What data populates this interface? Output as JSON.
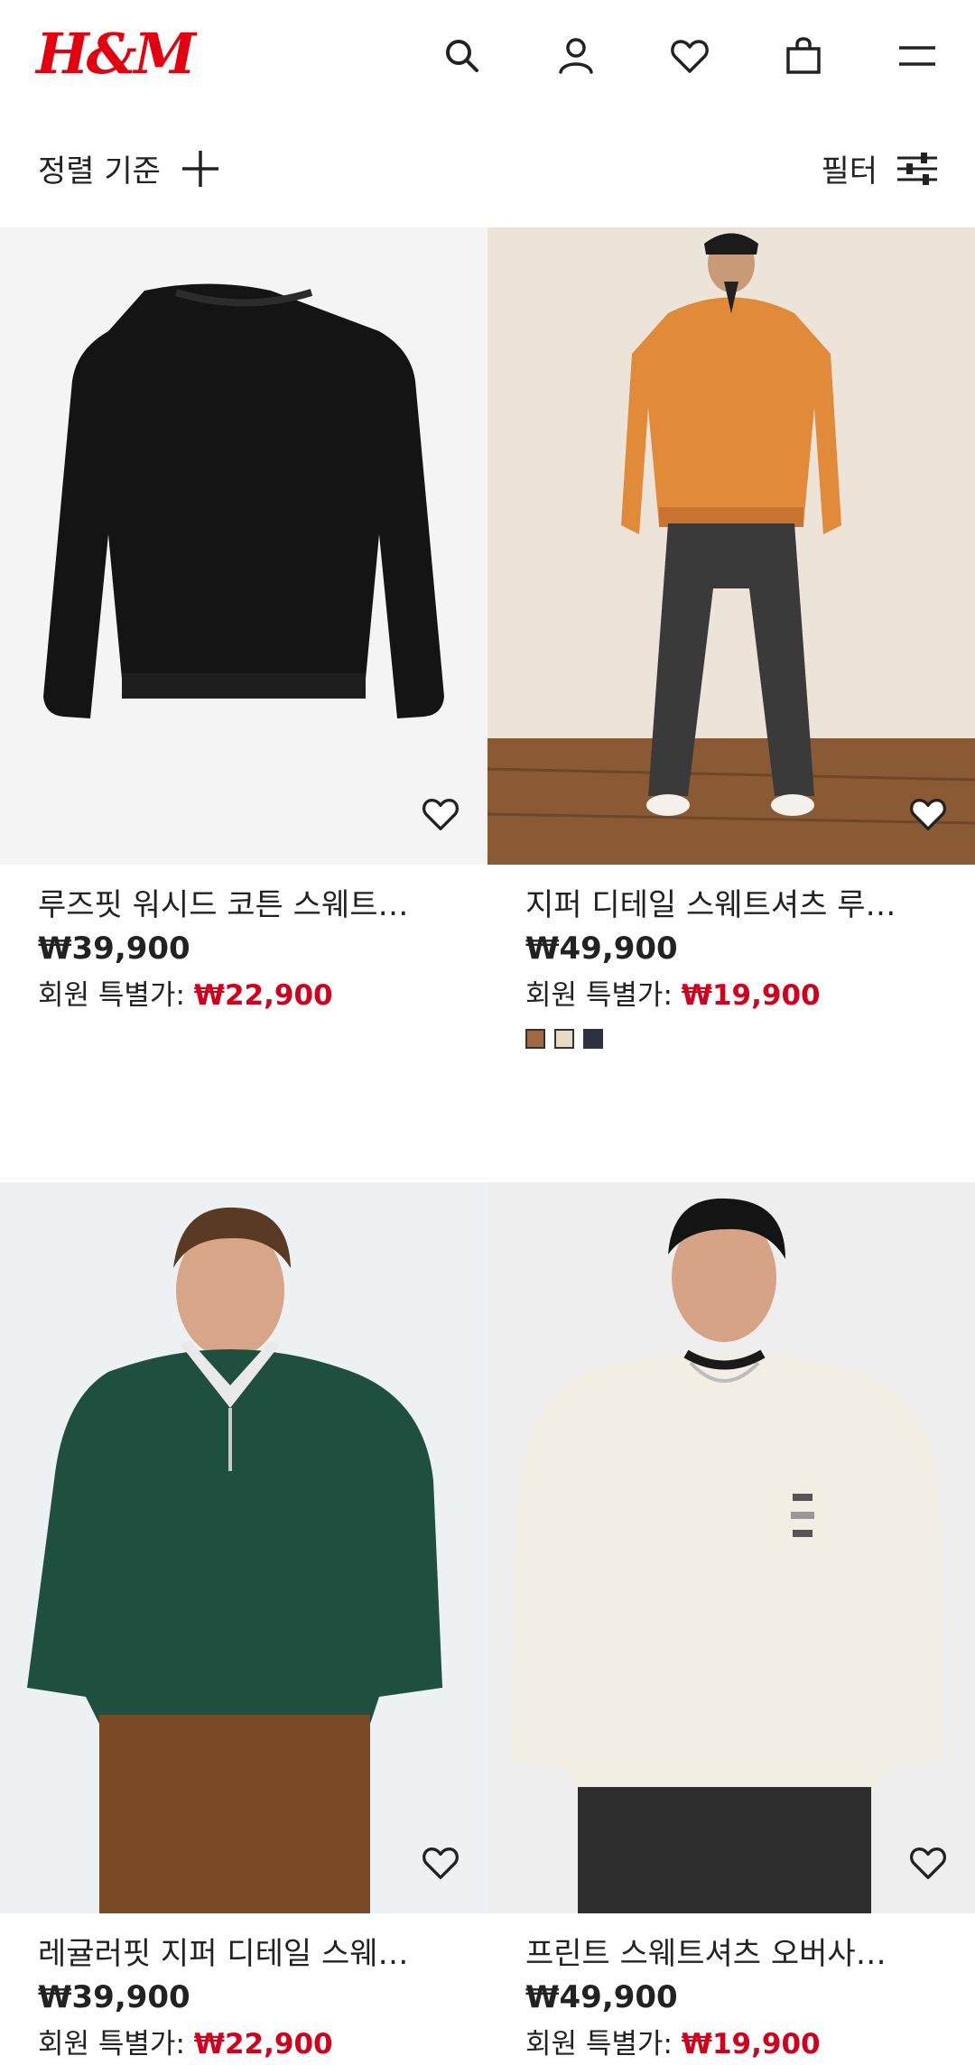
{
  "header": {
    "logo": "H&M",
    "icons": [
      "search-icon",
      "account-icon",
      "wishlist-icon",
      "shopping-bag-icon",
      "menu-icon"
    ]
  },
  "toolbar": {
    "sort_label": "정렬 기준",
    "filter_label": "필터"
  },
  "products": [
    {
      "name": "루즈핏 워시드 코튼 스웨트…",
      "price": "₩39,900",
      "member_label": "회원 특별가:",
      "member_price": "₩22,900",
      "swatches": []
    },
    {
      "name": "지퍼 디테일 스웨트셔츠 루…",
      "price": "₩49,900",
      "member_label": "회원 특별가:",
      "member_price": "₩19,900",
      "swatches": [
        "#a0693f",
        "#e6dcc4",
        "#2b3140"
      ]
    },
    {
      "name": "레귤러핏 지퍼 디테일 스웨…",
      "price": "₩39,900",
      "member_label": "회원 특별가:",
      "member_price": "₩22,900",
      "swatches": []
    },
    {
      "name": "프린트 스웨트셔츠 오버사…",
      "price": "₩49,900",
      "member_label": "회원 특별가:",
      "member_price": "₩19,900",
      "swatches": []
    }
  ],
  "colors": {
    "brand": "#e50010",
    "sale": "#d3001c"
  }
}
